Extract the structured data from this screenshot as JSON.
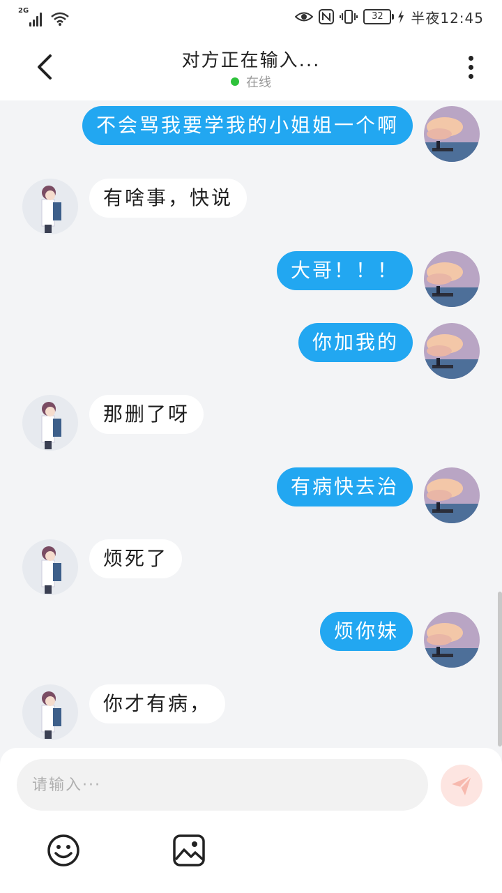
{
  "status_bar": {
    "network": "2G",
    "battery": "32",
    "time": "半夜12:45"
  },
  "header": {
    "title": "对方正在输入...",
    "status": "在线",
    "status_color": "#2ec23b"
  },
  "messages": [
    {
      "side": "sent",
      "text": "不会骂我要学我的小姐姐一个啊"
    },
    {
      "side": "recv",
      "text": "有啥事，快说"
    },
    {
      "side": "sent",
      "text": "大哥！！！"
    },
    {
      "side": "sent",
      "text": "你加我的"
    },
    {
      "side": "recv",
      "text": "那删了呀"
    },
    {
      "side": "sent",
      "text": "有病快去治"
    },
    {
      "side": "recv",
      "text": "烦死了"
    },
    {
      "side": "sent",
      "text": "烦你妹"
    },
    {
      "side": "recv",
      "text": "你才有病，"
    }
  ],
  "composer": {
    "placeholder": "请输入···",
    "value": ""
  },
  "colors": {
    "sent_bubble": "#22a7f1",
    "received_bubble": "#ffffff",
    "background": "#f3f4f6",
    "send_button": "#fde5e1"
  },
  "icons": {
    "back": "chevron-left-icon",
    "more": "more-vertical-icon",
    "send": "send-icon",
    "emoji": "emoji-icon",
    "image": "image-icon"
  }
}
